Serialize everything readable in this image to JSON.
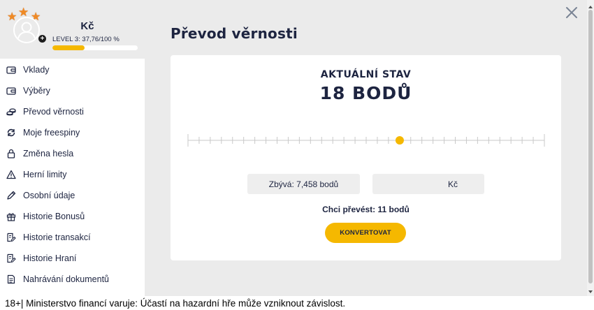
{
  "profile": {
    "currency": "Kč",
    "level_text": "LEVEL 3: 37,76/100 %",
    "level_progress": 0.3776
  },
  "sidebar": {
    "items": [
      {
        "label": "Vklady",
        "icon": "wallet-icon"
      },
      {
        "label": "Výběry",
        "icon": "wallet-out-icon"
      },
      {
        "label": "Převod věrnosti",
        "icon": "coins-icon"
      },
      {
        "label": "Moje freespiny",
        "icon": "refresh-icon"
      },
      {
        "label": "Změna hesla",
        "icon": "lock-icon"
      },
      {
        "label": "Herní limity",
        "icon": "warning-icon"
      },
      {
        "label": "Osobní údaje",
        "icon": "pencil-icon"
      },
      {
        "label": "Historie Bonusů",
        "icon": "gift-icon"
      },
      {
        "label": "Historie transakcí",
        "icon": "document-edit-icon"
      },
      {
        "label": "Historie Hraní",
        "icon": "document-edit-icon"
      },
      {
        "label": "Nahrávání dokumentů",
        "icon": "document-icon"
      }
    ]
  },
  "main": {
    "title": "Převod věrnosti",
    "status_label": "AKTUÁLNÍ STAV",
    "status_value": "18 BODŮ",
    "slider": {
      "ticks": 33,
      "value_fraction": 0.594
    },
    "remaining": "Zbývá: 7,458 bodů",
    "amount_input": {
      "value": "",
      "unit": "Kč"
    },
    "transfer_text": "Chci převést: 11 bodů",
    "convert_label": "KONVERTOVAT"
  },
  "footer": {
    "text": "18+| Ministerstvo financí varuje: Účastí na hazardní hře může vzniknout závislost."
  },
  "colors": {
    "accent": "#f5b800",
    "text": "#1d2440",
    "panel_bg": "#ebebeb",
    "star": "#f08a24"
  }
}
